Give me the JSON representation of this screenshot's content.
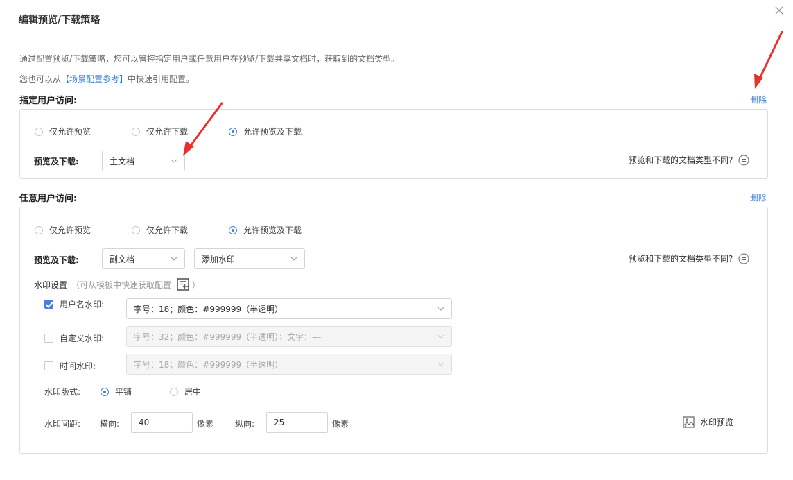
{
  "dialog": {
    "title": "编辑预览/下载策略",
    "description_line1": "通过配置预览/下载策略，您可以管控指定用户或任意用户在预览/下载共享文档时，获取到的文档类型。",
    "description_line2_prefix": "您也可以从",
    "description_line2_link": "【场景配置参考】",
    "description_line2_suffix": "中快速引用配置。"
  },
  "specified_user": {
    "title": "指定用户访问:",
    "delete_label": "删除",
    "radios": [
      "仅允许预览",
      "仅允许下载",
      "允许预览及下载"
    ],
    "selected_radio": 2,
    "field_label": "预览及下载:",
    "doc_select": "主文档",
    "hint": "预览和下载的文档类型不同?"
  },
  "any_user": {
    "title": "任意用户访问:",
    "delete_label": "删除",
    "radios": [
      "仅允许预览",
      "仅允许下载",
      "允许预览及下载"
    ],
    "selected_radio": 2,
    "field_label": "预览及下载:",
    "doc_select": "副文档",
    "watermark_select": "添加水印",
    "hint": "预览和下载的文档类型不同?",
    "watermark_settings_label": "水印设置",
    "watermark_settings_hint_open": "（可从模板中快速获取配置",
    "watermark_settings_hint_close": "）",
    "watermarks": [
      {
        "label": "用户名水印:",
        "checked": true,
        "value": "字号：18；颜色：#999999（半透明）",
        "disabled": false
      },
      {
        "label": "自定义水印:",
        "checked": false,
        "value": "字号：32；颜色：#999999（半透明）；文字：---",
        "disabled": true
      },
      {
        "label": "时间水印:",
        "checked": false,
        "value": "字号：18；颜色：#999999（半透明）",
        "disabled": true
      }
    ],
    "layout_label": "水印版式:",
    "layout_options": [
      "平铺",
      "居中"
    ],
    "layout_selected": 0,
    "spacing_label": "水印间距:",
    "horizontal_label": "横向:",
    "horizontal_value": "40",
    "vertical_label": "纵向:",
    "vertical_value": "25",
    "unit": "像素",
    "preview_label": "水印预览"
  },
  "colors": {
    "accent": "#4a7fd6",
    "annotation_arrow": "#e8312a"
  }
}
